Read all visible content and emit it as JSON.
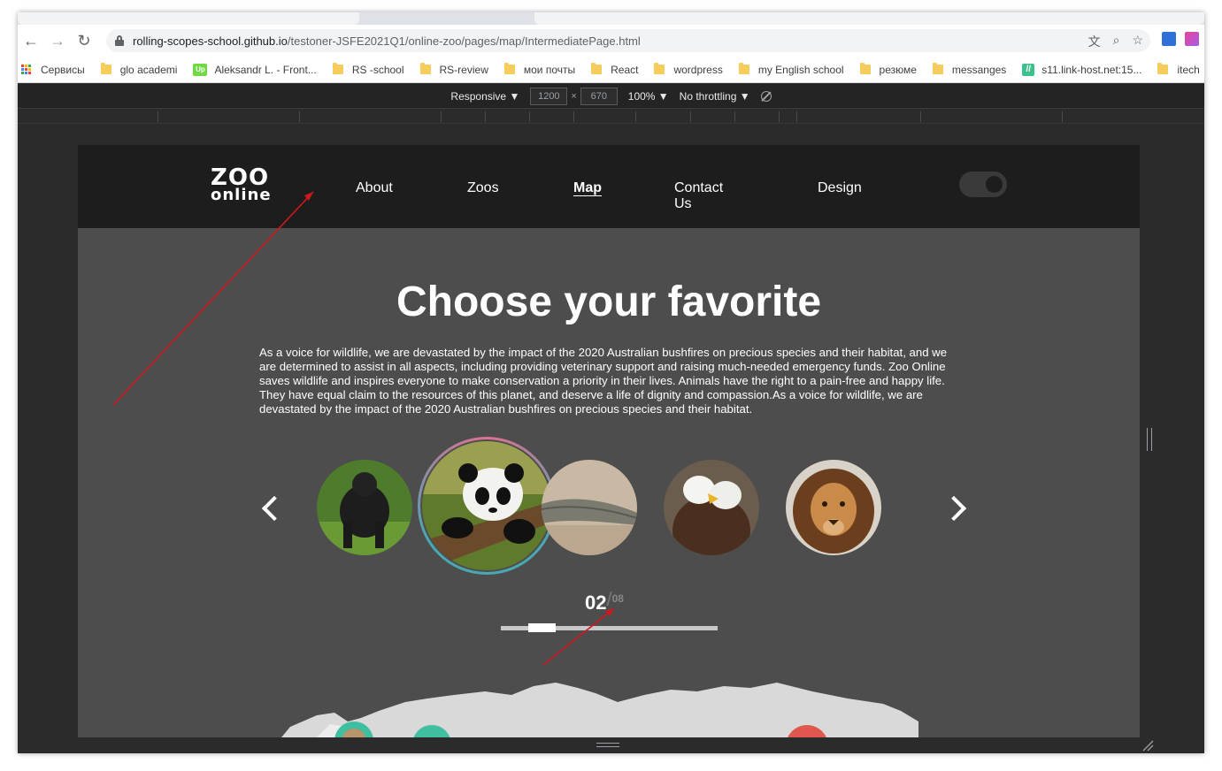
{
  "browser": {
    "url_host": "rolling-scopes-school.github.io",
    "url_path": "/testoner-JSFE2021Q1/online-zoo/pages/map/IntermediatePage.html",
    "icons": [
      "back-icon",
      "forward-icon",
      "reload-icon",
      "lock-icon",
      "translate-icon",
      "zoom-icon",
      "star-icon"
    ]
  },
  "bookmarks": [
    {
      "label": "Сервисы",
      "icon": "apps-icon"
    },
    {
      "label": "glo academi",
      "icon": "folder-icon"
    },
    {
      "label": "Aleksandr L. - Front...",
      "icon": "upwork-icon"
    },
    {
      "label": "RS -school",
      "icon": "folder-icon"
    },
    {
      "label": "RS-review",
      "icon": "folder-icon"
    },
    {
      "label": "мои почты",
      "icon": "folder-icon"
    },
    {
      "label": "React",
      "icon": "folder-icon"
    },
    {
      "label": "wordpress",
      "icon": "folder-icon"
    },
    {
      "label": "my English school",
      "icon": "folder-icon"
    },
    {
      "label": "резюме",
      "icon": "folder-icon"
    },
    {
      "label": "messanges",
      "icon": "folder-icon"
    },
    {
      "label": "s11.link-host.net:15...",
      "icon": "site-icon"
    },
    {
      "label": "itech",
      "icon": "folder-icon"
    }
  ],
  "devtools": {
    "device": "Responsive ▼",
    "width": "1200",
    "times": "×",
    "height": "670",
    "zoom": "100% ▼",
    "throttle": "No throttling ▼"
  },
  "site": {
    "logo_line1": "ZOO",
    "logo_line2": "online",
    "nav": {
      "about": "About",
      "zoos": "Zoos",
      "map": "Map",
      "contact": "Contact Us",
      "design": "Design"
    },
    "title": "Choose your favorite",
    "description": "As a voice for wildlife, we are devastated by the impact of the 2020 Australian bushfires on precious species and their habitat, and we are determined to assist in all aspects, including providing veterinary support and raising much-needed emergency funds. Zoo Online saves wildlife and inspires everyone to make conservation a priority in their lives. Animals have the right to a pain-free and happy life. They have equal claim to the resources of this planet, and deserve a life of dignity and compassion.As a voice for wildlife, we are devastated by the impact of the 2020 Australian bushfires on precious species and their habitat.",
    "animals": [
      "gorilla",
      "panda",
      "alligator",
      "eagle",
      "lion"
    ],
    "active_animal": "panda",
    "counter_current": "02",
    "counter_sep": "/",
    "counter_total": "08",
    "slider_progress": 0.125
  },
  "colors": {
    "header_bg": "#1d1d1d",
    "page_bg": "#4d4d4d",
    "annotation_arrow": "#d0181f"
  }
}
